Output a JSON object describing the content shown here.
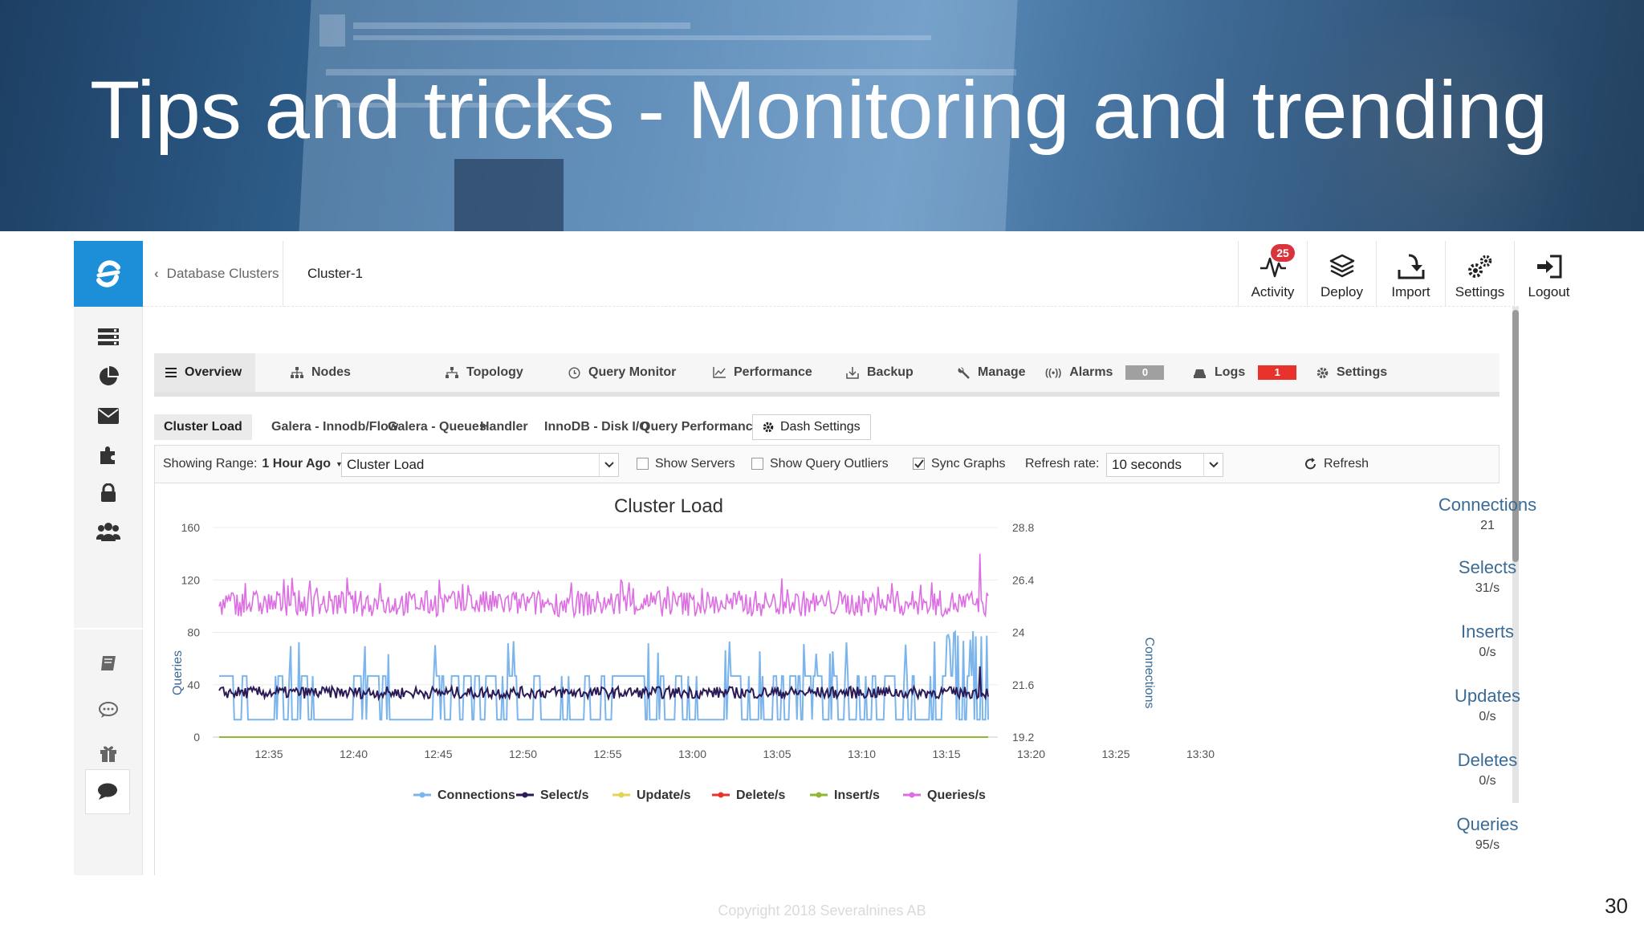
{
  "slide": {
    "title": "Tips and tricks - Monitoring and trending",
    "copyright": "Copyright 2018 Severalnines AB",
    "page_number": "30"
  },
  "topbar": {
    "breadcrumb": "Database Clusters",
    "cluster_name": "Cluster-1",
    "buttons": [
      {
        "label": "Activity",
        "icon": "activity-icon",
        "badge": "25"
      },
      {
        "label": "Deploy",
        "icon": "deploy-icon"
      },
      {
        "label": "Import",
        "icon": "import-icon"
      },
      {
        "label": "Settings",
        "icon": "settings-icon"
      },
      {
        "label": "Logout",
        "icon": "logout-icon"
      }
    ]
  },
  "sidebar": {
    "icons": [
      "servers-icon",
      "pie-chart-icon",
      "mail-icon",
      "puzzle-icon",
      "lock-icon",
      "users-icon",
      "book-icon",
      "comment-icon",
      "gift-icon",
      "chat-icon"
    ]
  },
  "tabs": [
    {
      "label": "Overview",
      "icon": "menu-icon",
      "active": true
    },
    {
      "label": "Nodes",
      "icon": "nodes-icon"
    },
    {
      "label": "Topology",
      "icon": "topology-icon"
    },
    {
      "label": "Query Monitor",
      "icon": "clock-icon"
    },
    {
      "label": "Performance",
      "icon": "line-chart-icon"
    },
    {
      "label": "Backup",
      "icon": "backup-icon"
    },
    {
      "label": "Manage",
      "icon": "wrench-icon"
    },
    {
      "label": "Alarms",
      "icon": "alarm-icon",
      "count": "0",
      "count_color": "#a0a0a0"
    },
    {
      "label": "Logs",
      "icon": "logs-icon",
      "count": "1",
      "count_color": "#e8332c"
    },
    {
      "label": "Settings",
      "icon": "gear-icon"
    }
  ],
  "subtabs": [
    {
      "label": "Cluster Load",
      "active": true
    },
    {
      "label": "Galera - Innodb/Flow"
    },
    {
      "label": "Galera - Queues"
    },
    {
      "label": "Handler"
    },
    {
      "label": "InnoDB - Disk I/O"
    },
    {
      "label": "Query Performance"
    },
    {
      "label": "Dash Settings",
      "button": true
    }
  ],
  "controls": {
    "range_label": "Showing Range:",
    "range_value": "1 Hour Ago",
    "dashboard_select": "Cluster Load",
    "show_servers": {
      "label": "Show Servers",
      "checked": false
    },
    "show_outliers": {
      "label": "Show Query Outliers",
      "checked": false
    },
    "sync_graphs": {
      "label": "Sync Graphs",
      "checked": true
    },
    "refresh_rate_label": "Refresh rate:",
    "refresh_rate_value": "10 seconds",
    "refresh_label": "Refresh"
  },
  "stats": [
    {
      "label": "Connections",
      "value": "21"
    },
    {
      "label": "Selects",
      "value": "31/s"
    },
    {
      "label": "Inserts",
      "value": "0/s"
    },
    {
      "label": "Updates",
      "value": "0/s"
    },
    {
      "label": "Deletes",
      "value": "0/s"
    },
    {
      "label": "Queries",
      "value": "95/s"
    }
  ],
  "chart_data": {
    "type": "line",
    "title": "Cluster Load",
    "ylabel": "Queries",
    "y2label": "Connections",
    "ylim": [
      0,
      160
    ],
    "y2lim": [
      19.2,
      28.8
    ],
    "yticks": [
      "160",
      "120",
      "80",
      "40",
      "0"
    ],
    "y2ticks": [
      "28.8",
      "26.4",
      "24",
      "21.6",
      "19.2"
    ],
    "xticks": [
      "12:35",
      "12:40",
      "12:45",
      "12:50",
      "12:55",
      "13:00",
      "13:05",
      "13:10",
      "13:15",
      "13:20",
      "13:25",
      "13:30"
    ],
    "legend_position": "bottom",
    "series": [
      {
        "name": "Connections",
        "color": "#7cb5ec",
        "axis": "right",
        "low": 20,
        "high": 22,
        "spikes": 23,
        "note": "toggles between ~20 and ~22 with occasional spikes to ~23-24"
      },
      {
        "name": "Select/s",
        "color": "#2b1a55",
        "axis": "left",
        "mean": 34,
        "range": [
          28,
          40
        ]
      },
      {
        "name": "Update/s",
        "color": "#e4d354",
        "axis": "left",
        "mean": 0
      },
      {
        "name": "Delete/s",
        "color": "#e8332c",
        "axis": "left",
        "mean": 0
      },
      {
        "name": "Insert/s",
        "color": "#90b832",
        "axis": "left",
        "mean": 0
      },
      {
        "name": "Queries/s",
        "color": "#dd6de3",
        "axis": "left",
        "mean": 102,
        "range": [
          88,
          122
        ]
      }
    ]
  }
}
